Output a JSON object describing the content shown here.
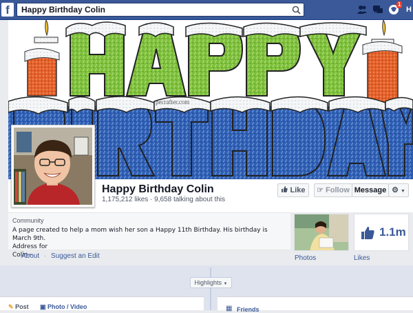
{
  "topbar": {
    "logo": "f",
    "search_value": "Happy Birthday Colin",
    "notif_count": "1",
    "home_label": "H"
  },
  "cover": {
    "watermark": "pecrafter.com"
  },
  "page": {
    "name": "Happy Birthday Colin",
    "stats": "1,175,212 likes · 9,658 talking about this"
  },
  "buttons": {
    "like": "Like",
    "follow": "Follow",
    "message": "Message"
  },
  "about": {
    "category": "Community",
    "description_line1": "A page created to help a mom wish her son a Happy 11th Birthday. His birthday is March 9th.",
    "description_line2": "Address for",
    "description_line3": "Colin~",
    "link_about": "About",
    "link_suggest": "Suggest an Edit"
  },
  "tiles": {
    "photos_label": "Photos",
    "likes_label": "Likes",
    "likes_count": "1.1m"
  },
  "timeline": {
    "highlights": "Highlights",
    "post_label": "Post",
    "photo_video_label": "Photo / Video",
    "friends_label": "Friends"
  },
  "colors": {
    "brand": "#3b5998",
    "cover_green": "#7ec03c",
    "cover_blue": "#2f5fb4",
    "candle_orange": "#e4602a"
  },
  "icons": [
    "search-icon",
    "friend-requests-icon",
    "messages-icon",
    "notifications-icon",
    "thumbs-up-icon",
    "gear-icon",
    "post-icon",
    "photo-icon",
    "friends-icon"
  ]
}
